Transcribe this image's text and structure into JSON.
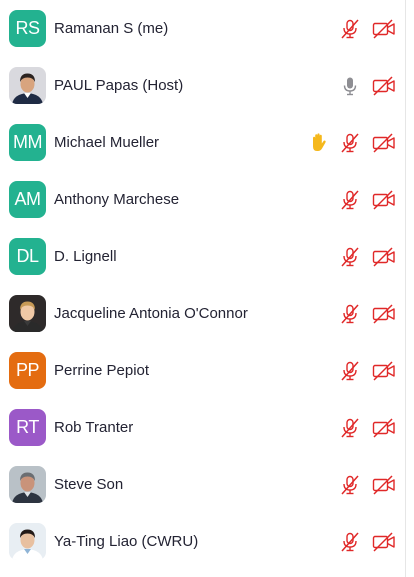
{
  "colors": {
    "muted_red": "#e02828",
    "mic_gray": "#8e8e93",
    "hand_yellow": "#f5b81c",
    "name_text": "#232333"
  },
  "participants": [
    {
      "name": "Ramanan S (me)",
      "initials": "RS",
      "avatar_color": "#23b290",
      "photo": false,
      "mic": "muted",
      "video": "off",
      "hand": false
    },
    {
      "name": "PAUL Papas (Host)",
      "initials": "",
      "avatar_color": "#3c3c44",
      "photo": true,
      "mic": "on",
      "video": "off",
      "hand": false
    },
    {
      "name": "Michael Mueller",
      "initials": "MM",
      "avatar_color": "#23b290",
      "photo": false,
      "mic": "muted",
      "video": "off",
      "hand": true
    },
    {
      "name": "Anthony Marchese",
      "initials": "AM",
      "avatar_color": "#23b290",
      "photo": false,
      "mic": "muted",
      "video": "off",
      "hand": false
    },
    {
      "name": "D. Lignell",
      "initials": "DL",
      "avatar_color": "#23b290",
      "photo": false,
      "mic": "muted",
      "video": "off",
      "hand": false
    },
    {
      "name": "Jacqueline Antonia O'Connor",
      "initials": "",
      "avatar_color": "#8a6d4a",
      "photo": true,
      "mic": "muted",
      "video": "off",
      "hand": false
    },
    {
      "name": "Perrine Pepiot",
      "initials": "PP",
      "avatar_color": "#e46c10",
      "photo": false,
      "mic": "muted",
      "video": "off",
      "hand": false
    },
    {
      "name": "Rob Tranter",
      "initials": "RT",
      "avatar_color": "#9b59c8",
      "photo": false,
      "mic": "muted",
      "video": "off",
      "hand": false
    },
    {
      "name": "Steve Son",
      "initials": "",
      "avatar_color": "#7f8a94",
      "photo": true,
      "mic": "muted",
      "video": "off",
      "hand": false
    },
    {
      "name": "Ya-Ting Liao (CWRU)",
      "initials": "",
      "avatar_color": "#c9dbe8",
      "photo": true,
      "mic": "muted",
      "video": "off",
      "hand": false
    }
  ]
}
